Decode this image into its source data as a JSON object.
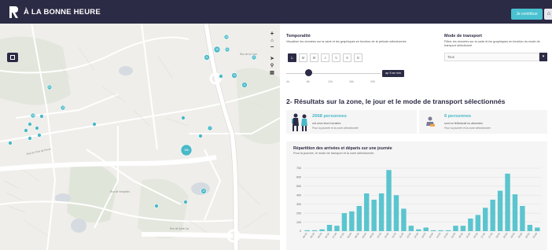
{
  "header": {
    "app_title": "À LA BONNE HEURE",
    "contribute_label": "Je contribue",
    "home_icon": "home-icon"
  },
  "map": {
    "zoom_in": "+",
    "zoom_out": "−",
    "markers": [
      "18",
      "41",
      "38",
      "11",
      "21",
      "2",
      "20",
      "11",
      "3",
      "7",
      "13",
      "3",
      "12",
      "19",
      "11",
      "21",
      "15",
      "4",
      "18",
      "4",
      "2",
      "5",
      "26",
      "4",
      "8",
      "2",
      "288",
      "20",
      "18",
      "18",
      "1",
      "6"
    ],
    "street_labels": [
      "Rue du Pont de Pierre",
      "Rue de Versailles",
      "Rue de Saint-Cyr",
      "Rue de la Croix"
    ]
  },
  "temporalite": {
    "title": "Temporalité",
    "description": "Visualiser les données sur la carte et les graphiques en fonction de la période sélectionnée",
    "days": [
      "L",
      "M",
      "M",
      "J",
      "V",
      "S",
      "D"
    ],
    "active_day": 0,
    "slider_value_label": "ap 5 se min",
    "slider_ticks": [
      "4h",
      "8h",
      "12h",
      "16h",
      "20h"
    ]
  },
  "transport": {
    "title": "Mode de transport",
    "description": "Filtrer les données sur la carte et les graphiques en fonction du mode de transport sélectionné",
    "selected": "Tous"
  },
  "results": {
    "title": "2- Résultats sur la zone, le jour et le mode de transport sélectionnés"
  },
  "stats": [
    {
      "number": "2668 personnes",
      "desc": "ont ceux leurs horaires",
      "note": "Pour la journée et la zone sélectionnée"
    },
    {
      "number": "6 personnes",
      "desc": "sont en télétravail ou absentes",
      "note": "Pour la journée et la zone sélectionnée"
    }
  ],
  "chart_section": {
    "title": "Répartition des arrivées et départs sur une journée",
    "subtitle": "Pour la journée, le mode de transport et la zone sélectionnés"
  },
  "chart_data": {
    "type": "bar",
    "ylim": [
      0,
      700
    ],
    "yticks": [
      0,
      100,
      200,
      300,
      400,
      500,
      600,
      700
    ],
    "grid": true,
    "color": "#5bc5cf",
    "categories": [
      "05:00",
      "05:30",
      "06:00",
      "06:30",
      "07:00",
      "07:30",
      "08:00",
      "08:30",
      "09:00",
      "09:30",
      "10:00",
      "10:30",
      "11:00",
      "11:30",
      "12:00",
      "12:30",
      "13:00",
      "13:30",
      "14:00",
      "14:30",
      "15:00",
      "15:30",
      "16:00",
      "16:30",
      "17:00",
      "17:30",
      "18:00",
      "18:30",
      "19:00",
      "19:30",
      "20:00",
      "20:30"
    ],
    "values": [
      10,
      10,
      20,
      70,
      60,
      200,
      220,
      280,
      420,
      350,
      420,
      680,
      400,
      250,
      60,
      20,
      40,
      10,
      10,
      10,
      60,
      60,
      140,
      180,
      260,
      350,
      450,
      640,
      410,
      280,
      70,
      40
    ]
  }
}
